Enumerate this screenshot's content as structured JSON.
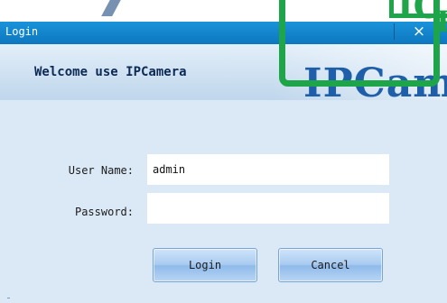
{
  "dialog": {
    "title": "Login",
    "close_label": "×",
    "close_icon": "close-icon",
    "welcome": "Welcome use IPCamera",
    "brand": {
      "main": "IPCam",
      "overlay_top": "IC",
      "overlay_bottom": "P"
    },
    "form": {
      "username_label": "User Name:",
      "username_value": "admin",
      "password_label": "Password:",
      "password_value": ""
    },
    "buttons": {
      "login": "Login",
      "cancel": "Cancel"
    }
  },
  "colors": {
    "titlebar": "#0d77bf",
    "dialog_bg": "#dbe9f7",
    "brand_blue": "#1f5fa9",
    "brand_green": "#1ea54a"
  }
}
